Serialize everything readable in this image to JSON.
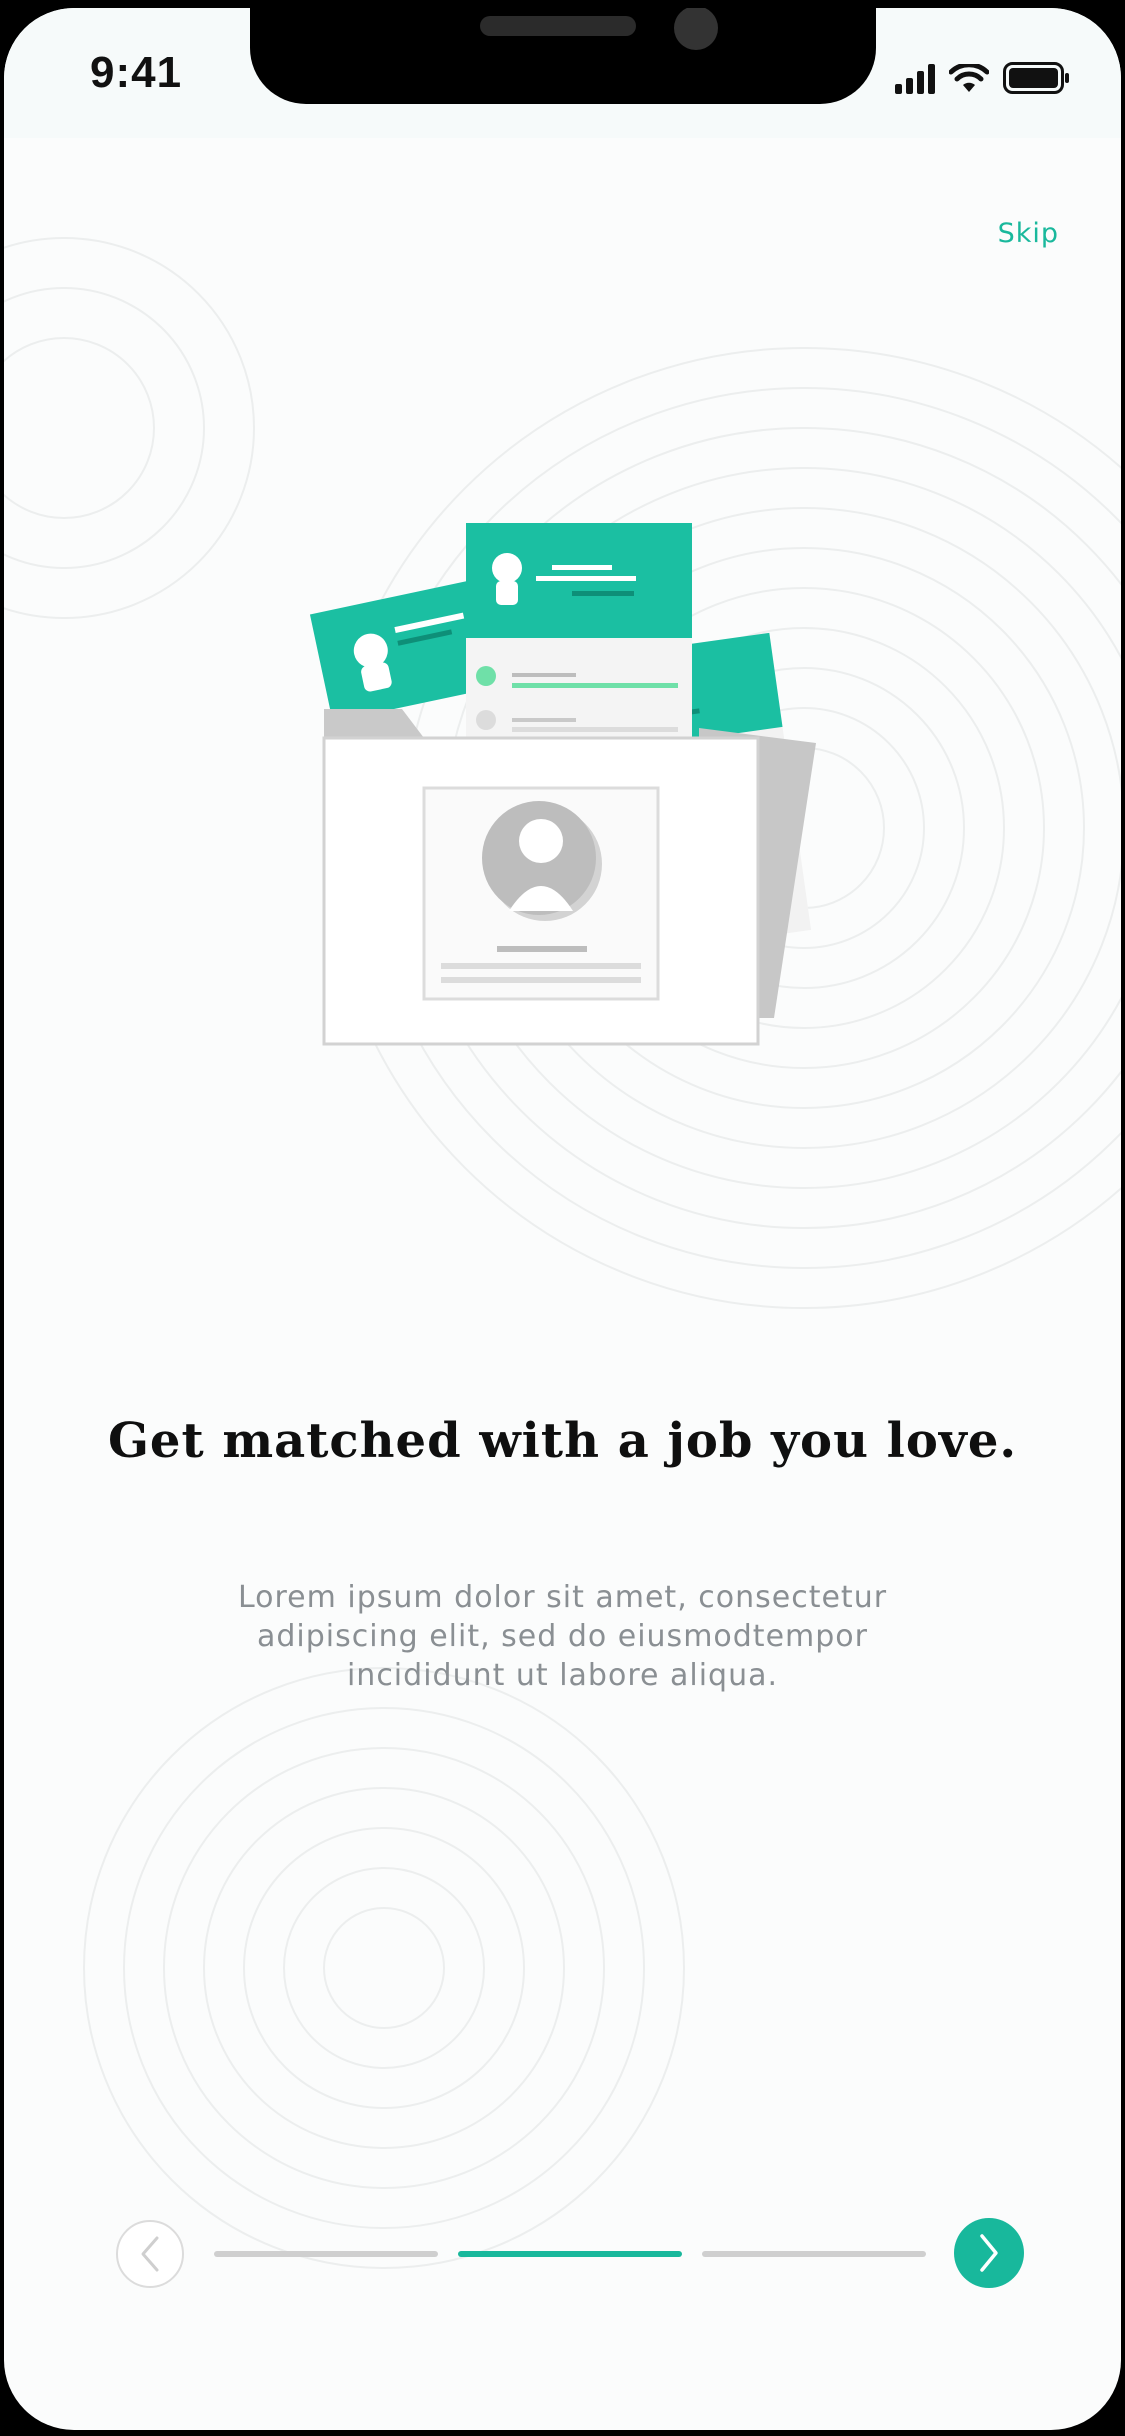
{
  "status_bar": {
    "time": "9:41",
    "icons": [
      "signal-icon",
      "wifi-icon",
      "battery-icon"
    ]
  },
  "header": {
    "skip_label": "Skip"
  },
  "onboarding": {
    "illustration": "job-profile-cards-illustration",
    "headline": "Get matched with a job you love.",
    "body_lines": [
      "Lorem ipsum dolor sit amet, consectetur",
      "adipiscing elit, sed do eiusmodtempor",
      "incididunt ut labore aliqua."
    ]
  },
  "pager": {
    "page_count": 3,
    "current_page": 2,
    "prev_icon": "chevron-left-icon",
    "next_icon": "chevron-right-icon"
  },
  "colors": {
    "accent": "#19b89c",
    "headline": "#0f0f0f",
    "body_text": "#8a8f93",
    "inactive_segment": "#cfcfcf",
    "background": "#fbfcfc"
  }
}
